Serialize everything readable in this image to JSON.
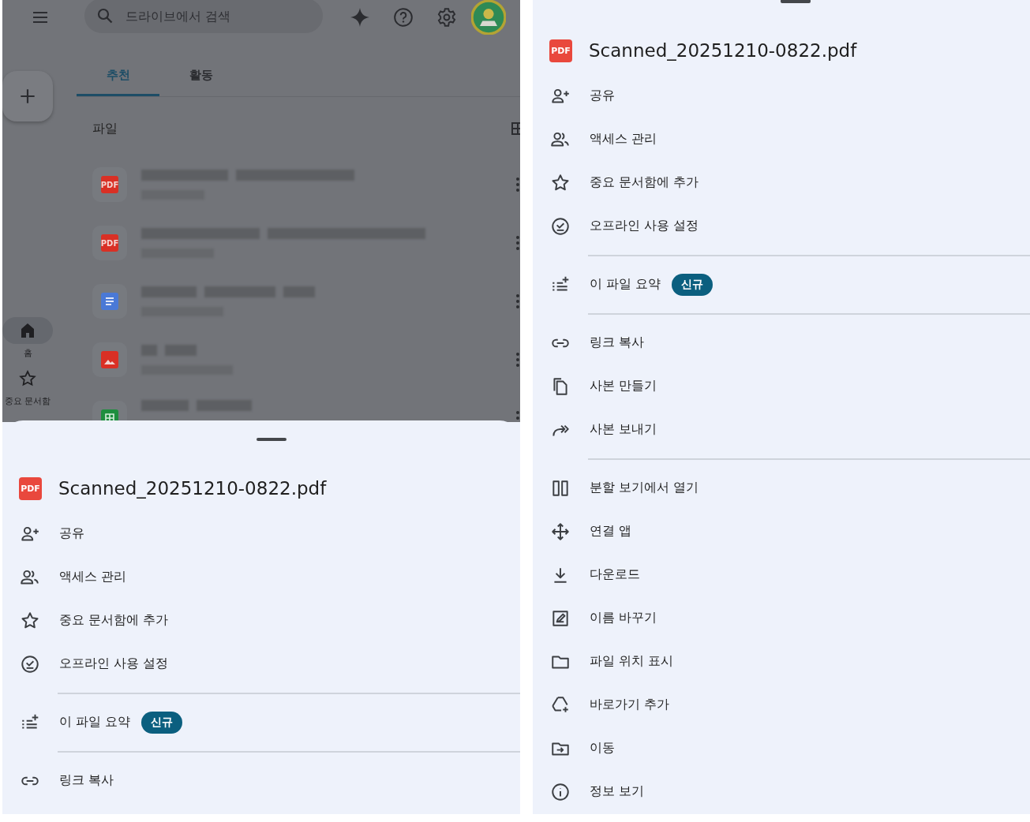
{
  "left_screen": {
    "search": {
      "placeholder": "드라이브에서 검색"
    },
    "tabs": [
      {
        "label": "추천",
        "selected": true
      },
      {
        "label": "활동",
        "selected": false
      }
    ],
    "section_title": "파일",
    "files": [
      {
        "kind": "pdf",
        "icon_text": "PDF"
      },
      {
        "kind": "pdf",
        "icon_text": "PDF"
      },
      {
        "kind": "doc"
      },
      {
        "kind": "image"
      },
      {
        "kind": "sheet"
      }
    ],
    "nav": [
      {
        "kind": "home",
        "label": "홈",
        "selected": true
      },
      {
        "kind": "starred",
        "label": "중요 문서함",
        "selected": false
      }
    ],
    "sheet": {
      "icon_text": "PDF",
      "file_name": "Scanned_20251210-0822.pdf",
      "items": [
        {
          "kind": "share",
          "label": "공유"
        },
        {
          "kind": "manage",
          "label": "액세스 관리"
        },
        {
          "kind": "star",
          "label": "중요 문서함에 추가"
        },
        {
          "kind": "offline",
          "label": "오프라인 사용 설정"
        },
        {
          "kind": "summary",
          "label": "이 파일 요약",
          "badge": "신규",
          "divider_before": true
        },
        {
          "kind": "link",
          "label": "링크 복사",
          "divider_before": true
        }
      ]
    }
  },
  "right_screen": {
    "sheet": {
      "icon_text": "PDF",
      "file_name": "Scanned_20251210-0822.pdf",
      "items": [
        {
          "kind": "share",
          "label": "공유"
        },
        {
          "kind": "manage",
          "label": "액세스 관리"
        },
        {
          "kind": "star",
          "label": "중요 문서함에 추가"
        },
        {
          "kind": "offline",
          "label": "오프라인 사용 설정"
        },
        {
          "kind": "summary",
          "label": "이 파일 요약",
          "badge": "신규",
          "divider_before": true
        },
        {
          "kind": "link",
          "label": "링크 복사",
          "divider_before": true
        },
        {
          "kind": "copy",
          "label": "사본 만들기"
        },
        {
          "kind": "send",
          "label": "사본 보내기"
        },
        {
          "kind": "split",
          "label": "분할 보기에서 열기",
          "divider_before": true
        },
        {
          "kind": "apps",
          "label": "연결 앱"
        },
        {
          "kind": "download",
          "label": "다운로드"
        },
        {
          "kind": "rename",
          "label": "이름 바꾸기"
        },
        {
          "kind": "folder",
          "label": "파일 위치 표시"
        },
        {
          "kind": "shortcut",
          "label": "바로가기 추가"
        },
        {
          "kind": "move",
          "label": "이동"
        },
        {
          "kind": "info",
          "label": "정보 보기"
        }
      ]
    }
  }
}
